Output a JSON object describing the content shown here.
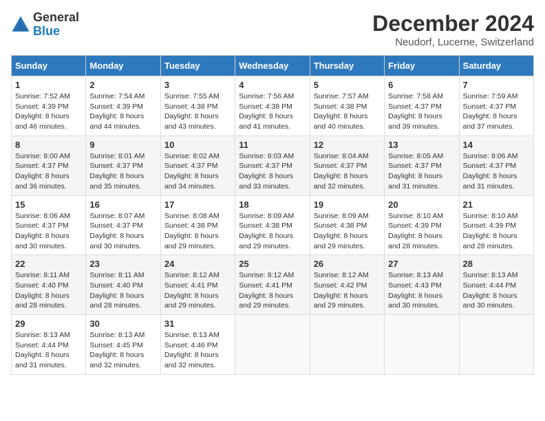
{
  "header": {
    "logo_general": "General",
    "logo_blue": "Blue",
    "month_title": "December 2024",
    "location": "Neudorf, Lucerne, Switzerland"
  },
  "calendar": {
    "days_of_week": [
      "Sunday",
      "Monday",
      "Tuesday",
      "Wednesday",
      "Thursday",
      "Friday",
      "Saturday"
    ],
    "weeks": [
      [
        {
          "day": "1",
          "sunrise": "Sunrise: 7:52 AM",
          "sunset": "Sunset: 4:39 PM",
          "daylight": "Daylight: 8 hours and 46 minutes."
        },
        {
          "day": "2",
          "sunrise": "Sunrise: 7:54 AM",
          "sunset": "Sunset: 4:39 PM",
          "daylight": "Daylight: 8 hours and 44 minutes."
        },
        {
          "day": "3",
          "sunrise": "Sunrise: 7:55 AM",
          "sunset": "Sunset: 4:38 PM",
          "daylight": "Daylight: 8 hours and 43 minutes."
        },
        {
          "day": "4",
          "sunrise": "Sunrise: 7:56 AM",
          "sunset": "Sunset: 4:38 PM",
          "daylight": "Daylight: 8 hours and 41 minutes."
        },
        {
          "day": "5",
          "sunrise": "Sunrise: 7:57 AM",
          "sunset": "Sunset: 4:38 PM",
          "daylight": "Daylight: 8 hours and 40 minutes."
        },
        {
          "day": "6",
          "sunrise": "Sunrise: 7:58 AM",
          "sunset": "Sunset: 4:37 PM",
          "daylight": "Daylight: 8 hours and 39 minutes."
        },
        {
          "day": "7",
          "sunrise": "Sunrise: 7:59 AM",
          "sunset": "Sunset: 4:37 PM",
          "daylight": "Daylight: 8 hours and 37 minutes."
        }
      ],
      [
        {
          "day": "8",
          "sunrise": "Sunrise: 8:00 AM",
          "sunset": "Sunset: 4:37 PM",
          "daylight": "Daylight: 8 hours and 36 minutes."
        },
        {
          "day": "9",
          "sunrise": "Sunrise: 8:01 AM",
          "sunset": "Sunset: 4:37 PM",
          "daylight": "Daylight: 8 hours and 35 minutes."
        },
        {
          "day": "10",
          "sunrise": "Sunrise: 8:02 AM",
          "sunset": "Sunset: 4:37 PM",
          "daylight": "Daylight: 8 hours and 34 minutes."
        },
        {
          "day": "11",
          "sunrise": "Sunrise: 8:03 AM",
          "sunset": "Sunset: 4:37 PM",
          "daylight": "Daylight: 8 hours and 33 minutes."
        },
        {
          "day": "12",
          "sunrise": "Sunrise: 8:04 AM",
          "sunset": "Sunset: 4:37 PM",
          "daylight": "Daylight: 8 hours and 32 minutes."
        },
        {
          "day": "13",
          "sunrise": "Sunrise: 8:05 AM",
          "sunset": "Sunset: 4:37 PM",
          "daylight": "Daylight: 8 hours and 31 minutes."
        },
        {
          "day": "14",
          "sunrise": "Sunrise: 8:06 AM",
          "sunset": "Sunset: 4:37 PM",
          "daylight": "Daylight: 8 hours and 31 minutes."
        }
      ],
      [
        {
          "day": "15",
          "sunrise": "Sunrise: 8:06 AM",
          "sunset": "Sunset: 4:37 PM",
          "daylight": "Daylight: 8 hours and 30 minutes."
        },
        {
          "day": "16",
          "sunrise": "Sunrise: 8:07 AM",
          "sunset": "Sunset: 4:37 PM",
          "daylight": "Daylight: 8 hours and 30 minutes."
        },
        {
          "day": "17",
          "sunrise": "Sunrise: 8:08 AM",
          "sunset": "Sunset: 4:38 PM",
          "daylight": "Daylight: 8 hours and 29 minutes."
        },
        {
          "day": "18",
          "sunrise": "Sunrise: 8:09 AM",
          "sunset": "Sunset: 4:38 PM",
          "daylight": "Daylight: 8 hours and 29 minutes."
        },
        {
          "day": "19",
          "sunrise": "Sunrise: 8:09 AM",
          "sunset": "Sunset: 4:38 PM",
          "daylight": "Daylight: 8 hours and 29 minutes."
        },
        {
          "day": "20",
          "sunrise": "Sunrise: 8:10 AM",
          "sunset": "Sunset: 4:39 PM",
          "daylight": "Daylight: 8 hours and 28 minutes."
        },
        {
          "day": "21",
          "sunrise": "Sunrise: 8:10 AM",
          "sunset": "Sunset: 4:39 PM",
          "daylight": "Daylight: 8 hours and 28 minutes."
        }
      ],
      [
        {
          "day": "22",
          "sunrise": "Sunrise: 8:11 AM",
          "sunset": "Sunset: 4:40 PM",
          "daylight": "Daylight: 8 hours and 28 minutes."
        },
        {
          "day": "23",
          "sunrise": "Sunrise: 8:11 AM",
          "sunset": "Sunset: 4:40 PM",
          "daylight": "Daylight: 8 hours and 28 minutes."
        },
        {
          "day": "24",
          "sunrise": "Sunrise: 8:12 AM",
          "sunset": "Sunset: 4:41 PM",
          "daylight": "Daylight: 8 hours and 29 minutes."
        },
        {
          "day": "25",
          "sunrise": "Sunrise: 8:12 AM",
          "sunset": "Sunset: 4:41 PM",
          "daylight": "Daylight: 8 hours and 29 minutes."
        },
        {
          "day": "26",
          "sunrise": "Sunrise: 8:12 AM",
          "sunset": "Sunset: 4:42 PM",
          "daylight": "Daylight: 8 hours and 29 minutes."
        },
        {
          "day": "27",
          "sunrise": "Sunrise: 8:13 AM",
          "sunset": "Sunset: 4:43 PM",
          "daylight": "Daylight: 8 hours and 30 minutes."
        },
        {
          "day": "28",
          "sunrise": "Sunrise: 8:13 AM",
          "sunset": "Sunset: 4:44 PM",
          "daylight": "Daylight: 8 hours and 30 minutes."
        }
      ],
      [
        {
          "day": "29",
          "sunrise": "Sunrise: 8:13 AM",
          "sunset": "Sunset: 4:44 PM",
          "daylight": "Daylight: 8 hours and 31 minutes."
        },
        {
          "day": "30",
          "sunrise": "Sunrise: 8:13 AM",
          "sunset": "Sunset: 4:45 PM",
          "daylight": "Daylight: 8 hours and 32 minutes."
        },
        {
          "day": "31",
          "sunrise": "Sunrise: 8:13 AM",
          "sunset": "Sunset: 4:46 PM",
          "daylight": "Daylight: 8 hours and 32 minutes."
        },
        null,
        null,
        null,
        null
      ]
    ]
  }
}
